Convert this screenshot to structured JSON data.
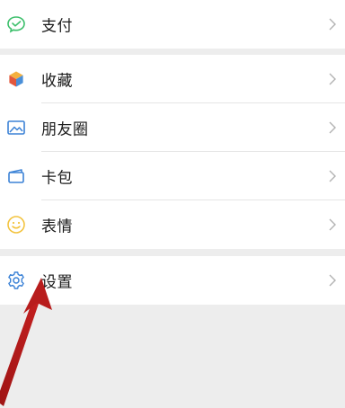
{
  "colors": {
    "page_background": "#ededed",
    "row_background": "#ffffff",
    "label_text": "#1a1a1a",
    "chevron": "#b2b2b2",
    "pay_icon": "#3cbf6b",
    "collect_icon_accents": [
      "#f4b03e",
      "#e2573c",
      "#4a8fd8",
      "#3cbf6b"
    ],
    "moments_icon": "#3b82d6",
    "cards_icon": "#3b82d6",
    "sticker_icon": "#f3c33d",
    "settings_icon": "#3b82d6",
    "annotation_arrow": "#b81d1d"
  },
  "menu": {
    "pay": {
      "label": "支付",
      "icon": "wechat-pay-icon"
    },
    "collections": {
      "label": "收藏",
      "icon": "cube-icon"
    },
    "moments": {
      "label": "朋友圈",
      "icon": "image-icon"
    },
    "cards": {
      "label": "卡包",
      "icon": "card-wallet-icon"
    },
    "stickers": {
      "label": "表情",
      "icon": "smiley-icon"
    },
    "settings": {
      "label": "设置",
      "icon": "gear-icon"
    }
  },
  "annotation": {
    "type": "arrow",
    "points_to": "settings"
  }
}
